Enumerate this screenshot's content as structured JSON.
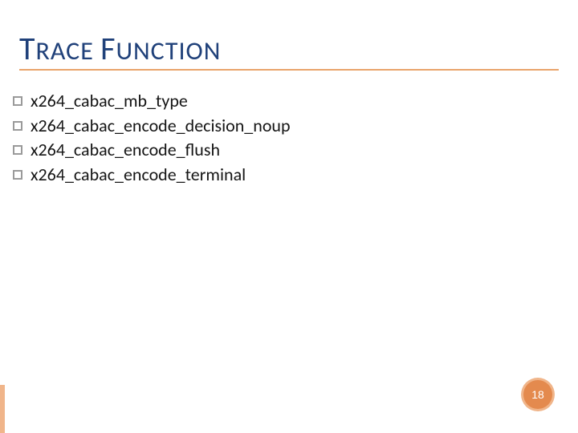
{
  "title": {
    "word1_cap": "T",
    "word1_rest": "RACE",
    "word2_cap": "F",
    "word2_rest": "UNCTION"
  },
  "items": [
    "x264_cabac_mb_type",
    "x264_cabac_encode_decision_noup",
    "x264_cabac_encode_flush",
    "x264_cabac_encode_terminal"
  ],
  "page_number": "18"
}
